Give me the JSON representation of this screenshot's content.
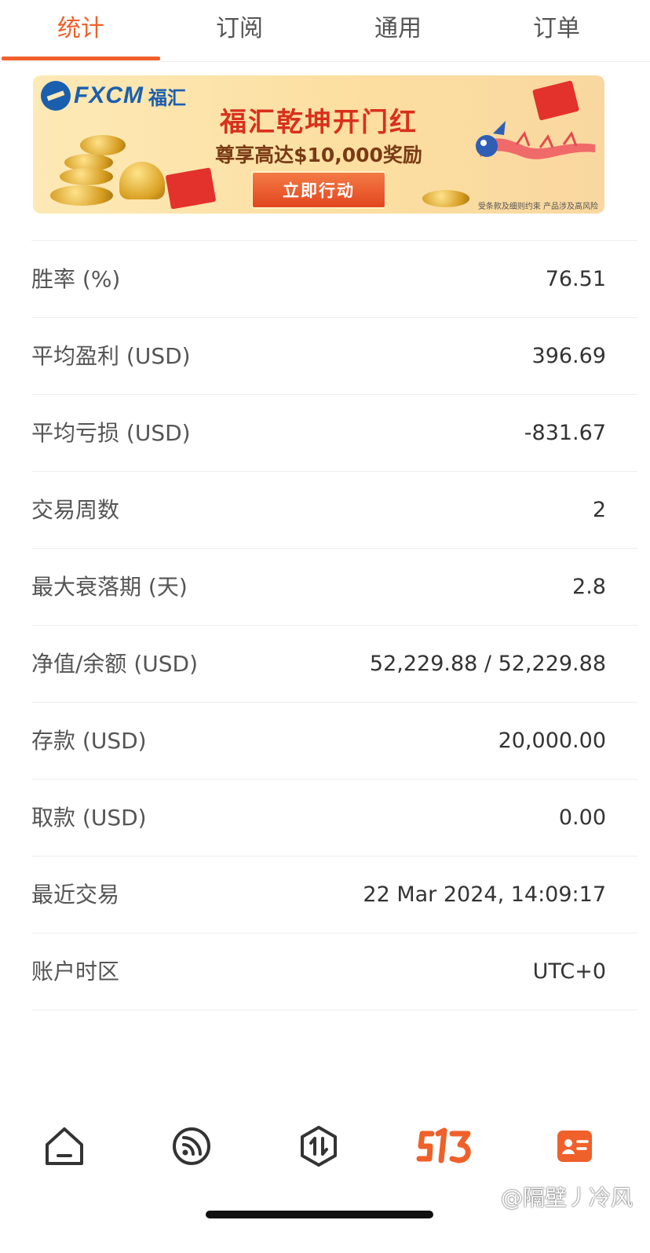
{
  "tabs": [
    {
      "label": "统计",
      "active": true
    },
    {
      "label": "订阅",
      "active": false
    },
    {
      "label": "通用",
      "active": false
    },
    {
      "label": "订单",
      "active": false
    }
  ],
  "banner": {
    "logo_text": "FXCM",
    "logo_cn": "福汇",
    "title": "福汇乾坤开门红",
    "subtitle": "尊享高达$10,000奖励",
    "button": "立即行动",
    "note": "受条款及细则约束  产品涉及高风险"
  },
  "stats": [
    {
      "label": "胜率 (%)",
      "value": "76.51"
    },
    {
      "label": "平均盈利 (USD)",
      "value": "396.69"
    },
    {
      "label": "平均亏损 (USD)",
      "value": "-831.67"
    },
    {
      "label": "交易周数",
      "value": "2"
    },
    {
      "label": "最大衰落期 (天)",
      "value": "2.8"
    },
    {
      "label": "净值/余额 (USD)",
      "value": "52,229.88 / 52,229.88"
    },
    {
      "label": "存款 (USD)",
      "value": "20,000.00"
    },
    {
      "label": "取款 (USD)",
      "value": "0.00"
    },
    {
      "label": "最近交易",
      "value": "22 Mar 2024, 14:09:17"
    },
    {
      "label": "账户时区",
      "value": "UTC+0"
    }
  ],
  "bottom_nav": [
    {
      "icon": "home-icon",
      "active": false
    },
    {
      "icon": "feed-icon",
      "active": false
    },
    {
      "icon": "trade-icon",
      "active": false
    },
    {
      "icon": "s13-logo-icon",
      "active": true
    },
    {
      "icon": "profile-card-icon",
      "active": true
    }
  ],
  "watermark": "@隔壁丿冷风",
  "colors": {
    "accent": "#f0602a",
    "text": "#333333",
    "label": "#555555",
    "divider": "#eeeeee"
  }
}
